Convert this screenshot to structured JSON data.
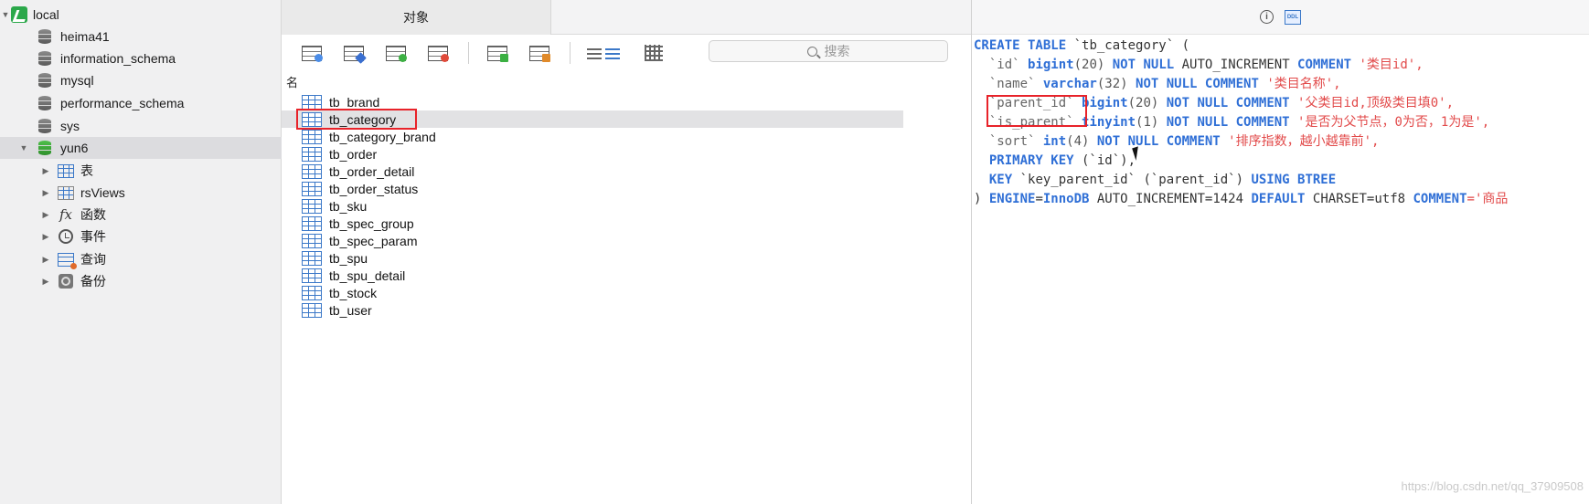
{
  "sidebar": {
    "connection": "local",
    "databases": [
      "heima41",
      "information_schema",
      "mysql",
      "performance_schema",
      "sys"
    ],
    "open_db": "yun6",
    "nodes": [
      "表",
      "rsViews",
      "函数",
      "事件",
      "查询",
      "备份"
    ]
  },
  "middle": {
    "tab": "对象",
    "search_placeholder": "搜索",
    "column_header": "名",
    "tables": [
      "tb_brand",
      "tb_category",
      "tb_category_brand",
      "tb_order",
      "tb_order_detail",
      "tb_order_status",
      "tb_sku",
      "tb_spec_group",
      "tb_spec_param",
      "tb_spu",
      "tb_spu_detail",
      "tb_stock",
      "tb_user"
    ],
    "selected_table": "tb_category"
  },
  "ddl": {
    "l1a": "CREATE TABLE",
    "l1b": " `tb_category` (",
    "l2a": "  `id` ",
    "l2b": "bigint",
    "l2c": "(20) ",
    "l2d": "NOT NULL",
    "l2e": " AUTO_INCREMENT ",
    "l2f": "COMMENT",
    "l2g": " '类目id',",
    "l3a": "  `name` ",
    "l3b": "varchar",
    "l3c": "(32) ",
    "l3d": "NOT NULL COMMENT",
    "l3e": " '类目名称',",
    "l4a": "  `parent_id` ",
    "l4b": "bigint",
    "l4c": "(20) ",
    "l4d": "NOT NULL COMMENT",
    "l4e": " '父类目id,顶级类目填0',",
    "l5a": "  `is_parent` ",
    "l5b": "tinyint",
    "l5c": "(1) ",
    "l5d": "NOT NULL COMMENT",
    "l5e": " '是否为父节点，0为否，1为是',",
    "l6a": "  `sort` ",
    "l6b": "int",
    "l6c": "(4) ",
    "l6d": "NOT NULL COMMENT",
    "l6e": " '排序指数，越小越靠前',",
    "l7a": "  PRIMARY KEY",
    "l7b": " (`id`),",
    "l8a": "  KEY",
    "l8b": " `key_parent_id` (`parent_id`) ",
    "l8c": "USING BTREE",
    "l9a": ") ",
    "l9b": "ENGINE",
    "l9c": "=",
    "l9d": "InnoDB",
    "l9e": " AUTO_INCREMENT=1424 ",
    "l9f": "DEFAULT",
    "l9g": " CHARSET=utf8 ",
    "l9h": "COMMENT",
    "l9i": "='商品"
  },
  "watermark": "https://blog.csdn.net/qq_37909508"
}
